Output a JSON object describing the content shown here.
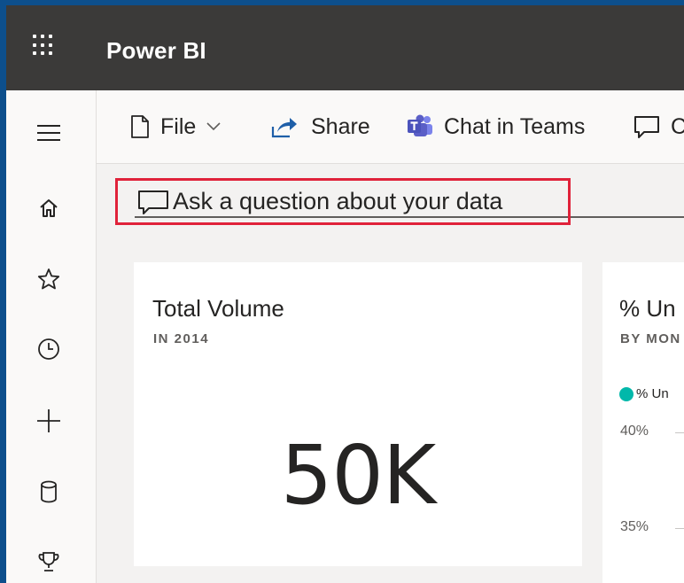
{
  "app": {
    "title": "Power BI"
  },
  "toolbar": {
    "file_label": "File",
    "share_label": "Share",
    "chat_label": "Chat in Teams",
    "comment_label": "C"
  },
  "qna": {
    "placeholder": "Ask a question about your data"
  },
  "leftnav": {
    "items": [
      "hamburger-icon",
      "home-icon",
      "star-icon",
      "clock-icon",
      "plus-icon",
      "database-icon",
      "trophy-icon"
    ]
  },
  "tiles": [
    {
      "title": "Total Volume",
      "subtitle": "IN 2014",
      "value": "50K"
    },
    {
      "title": "% Un",
      "subtitle": "BY MON",
      "legend": "% Un",
      "ticks": [
        "40%",
        "35%"
      ]
    }
  ],
  "colors": {
    "topbar": "#3b3a39",
    "accent_highlight": "#e0223a",
    "series_teal": "#01b8aa",
    "teams_purple": "#5b5fc7",
    "share_blue": "#1f5fa8"
  }
}
